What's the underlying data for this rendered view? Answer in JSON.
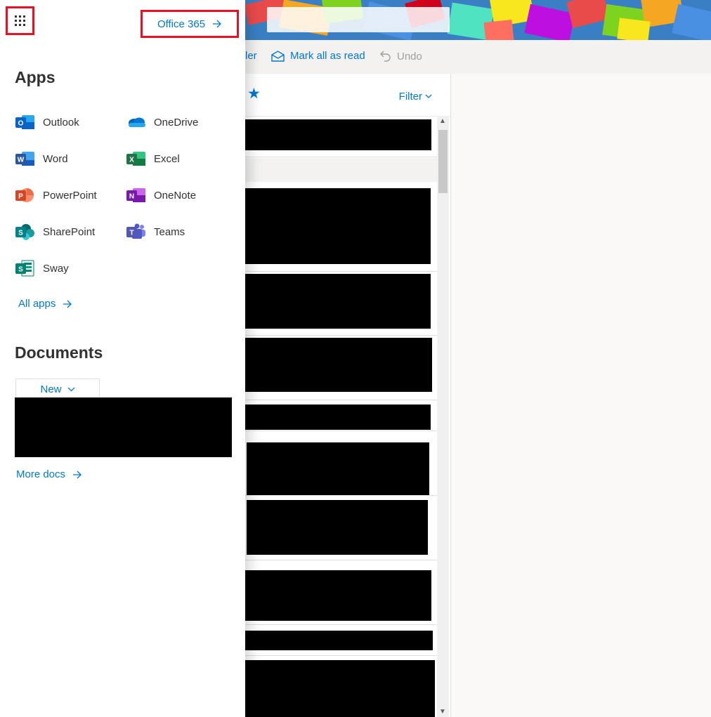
{
  "launcher": {
    "office365_label": "Office 365",
    "apps_heading": "Apps",
    "apps": [
      {
        "label": "Outlook",
        "icon": "outlook-icon"
      },
      {
        "label": "OneDrive",
        "icon": "onedrive-icon"
      },
      {
        "label": "Word",
        "icon": "word-icon"
      },
      {
        "label": "Excel",
        "icon": "excel-icon"
      },
      {
        "label": "PowerPoint",
        "icon": "powerpoint-icon"
      },
      {
        "label": "OneNote",
        "icon": "onenote-icon"
      },
      {
        "label": "SharePoint",
        "icon": "sharepoint-icon"
      },
      {
        "label": "Teams",
        "icon": "teams-icon"
      },
      {
        "label": "Sway",
        "icon": "sway-icon"
      }
    ],
    "all_apps_label": "All apps",
    "documents_heading": "Documents",
    "new_label": "New",
    "more_docs_label": "More docs"
  },
  "toolbar": {
    "move_label_fragment": "ler",
    "mark_all_read_label": "Mark all as read",
    "undo_label": "Undo"
  },
  "message_list": {
    "filter_label": "Filter"
  },
  "colors": {
    "accent": "#0078d4",
    "highlight_border": "#e81123",
    "outlook": "#0a64c8",
    "word": "#2b579a",
    "excel": "#217346",
    "powerpoint": "#d24726",
    "onenote": "#7719aa",
    "sharepoint": "#038387",
    "teams": "#5558af",
    "sway": "#008272",
    "onedrive": "#0364b8"
  }
}
